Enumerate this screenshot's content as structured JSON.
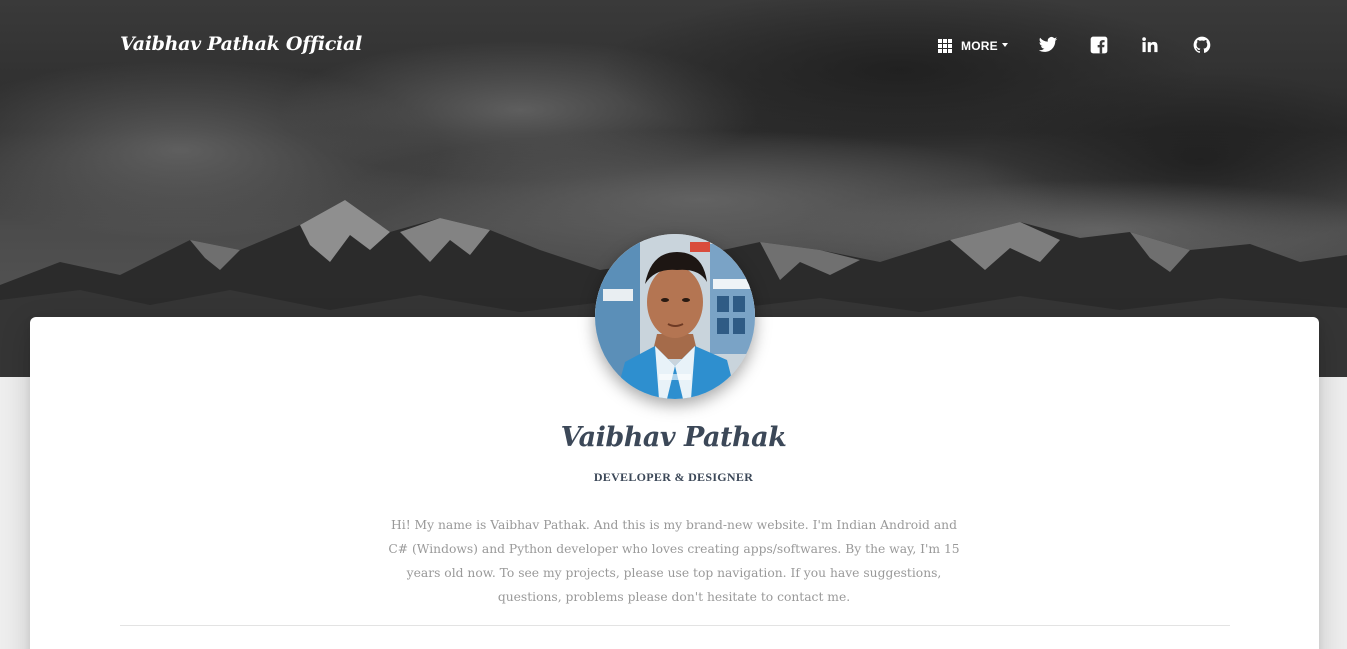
{
  "header": {
    "brand": "Vaibhav Pathak Official",
    "nav": {
      "more_label": "MORE",
      "more_icon": "grid-icon",
      "social": [
        {
          "icon": "twitter-icon"
        },
        {
          "icon": "facebook-icon"
        },
        {
          "icon": "linkedin-icon"
        },
        {
          "icon": "github-icon"
        }
      ]
    }
  },
  "profile": {
    "avatar": "profile-photo",
    "name": "Vaibhav Pathak",
    "title": "DEVELOPER & DESIGNER",
    "bio": "Hi! My name is Vaibhav Pathak. And this is my brand-new website. I'm Indian Android and C# (Windows) and Python developer who loves creating apps/softwares. By the way, I'm 15 years old now. To see my projects, please use top navigation. If you have suggestions, questions, problems please don't hesitate to contact me."
  },
  "colors": {
    "heading": "#3c4858",
    "body_text": "#999999",
    "page_bg": "#eeeeee",
    "card_bg": "#ffffff"
  }
}
